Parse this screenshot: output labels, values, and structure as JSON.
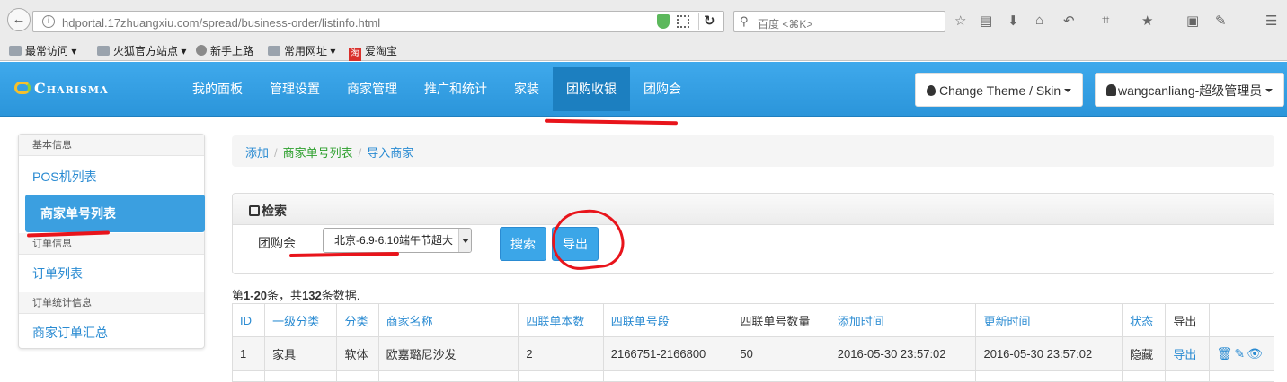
{
  "browser": {
    "url": "hdportal.17zhuangxiu.com/spread/business-order/listinfo.html",
    "search_placeholder": "百度 <⌘K>",
    "bookmarks": [
      "最常访问",
      "火狐官方站点",
      "新手上路",
      "常用网址",
      "爱淘宝"
    ]
  },
  "navbar": {
    "brand": "Charisma",
    "items": [
      "我的面板",
      "管理设置",
      "商家管理",
      "推广和统计",
      "家装",
      "团购收银",
      "团购会"
    ],
    "active_item": "团购收银",
    "theme_button": "Change Theme / Skin",
    "user_button": "wangcanliang-超级管理员"
  },
  "sidebar": {
    "sections": [
      {
        "header": "基本信息",
        "links": [
          "POS机列表",
          "商家单号列表"
        ]
      },
      {
        "header": "订单信息",
        "links": [
          "订单列表"
        ]
      },
      {
        "header": "订单统计信息",
        "links": [
          "商家订单汇总"
        ]
      }
    ],
    "active_link": "商家单号列表"
  },
  "breadcrumb": [
    "添加",
    "商家单号列表",
    "导入商家"
  ],
  "search_panel": {
    "title": "检索",
    "field_label": "团购会",
    "selected_option": "北京-6.9-6.10端午节超大",
    "search_button": "搜索",
    "export_button": "导出"
  },
  "summary": {
    "prefix": "第",
    "range": "1-20",
    "middle": "条，共",
    "total": "132",
    "suffix": "条数据."
  },
  "table": {
    "headers": [
      "ID",
      "一级分类",
      "分类",
      "商家名称",
      "四联单本数",
      "四联单号段",
      "四联单号数量",
      "添加时间",
      "更新时间",
      "状态",
      "导出",
      ""
    ],
    "rows": [
      [
        "1",
        "家具",
        "软体",
        "欧嘉璐尼沙发",
        "2",
        "2166751-2166800",
        "50",
        "2016-05-30 23:57:02",
        "2016-05-30 23:57:02",
        "隐藏",
        "导出"
      ]
    ]
  },
  "colors": {
    "navbar": "#2b95da",
    "link": "#2a8bd2",
    "annotation": "#e8141b"
  }
}
